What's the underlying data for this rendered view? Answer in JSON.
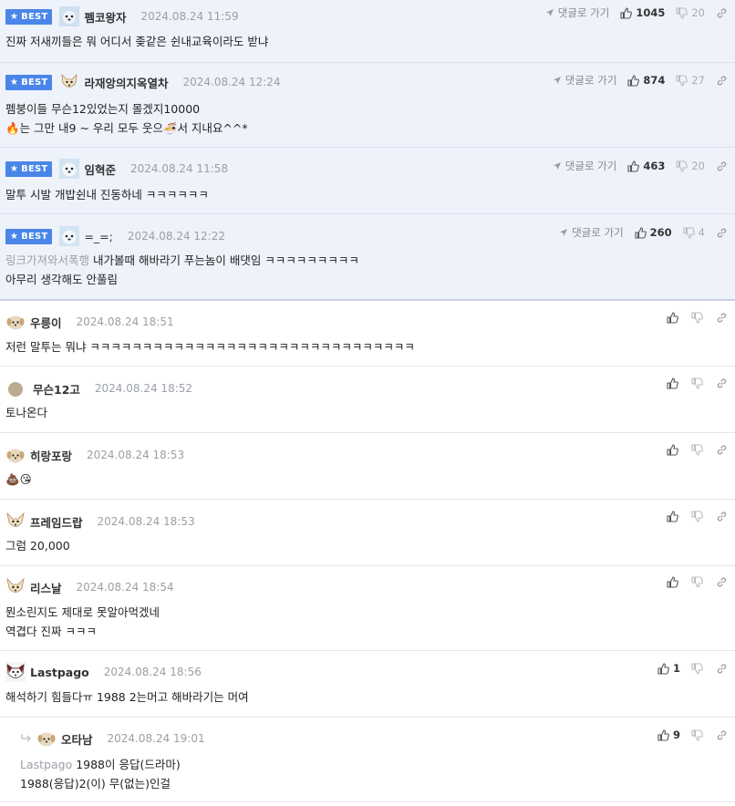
{
  "reply_label": "댓글로 가기",
  "best_label": "BEST",
  "best_comments": [
    {
      "nick": "펨코왕자",
      "date": "2024.08.24 11:59",
      "likes": "1045",
      "dislikes": "20",
      "lines": [
        "진짜 저새끼들은 뭐 어디서 좆같은 쉰내교육이라도 받냐"
      ]
    },
    {
      "nick": "라재앙의지옥열차",
      "date": "2024.08.24 12:24",
      "likes": "874",
      "dislikes": "27",
      "lines": [
        "펨붕이들 무슨12있었는지 몰겠지10000",
        "는 그만 내9 ~ 우리 모두 웃으",
        "서 지내요^^*"
      ]
    },
    {
      "nick": "임혁준",
      "date": "2024.08.24 11:58",
      "likes": "463",
      "dislikes": "20",
      "lines": [
        "말투 시발 개밥쉰내 진동하네 ㅋㅋㅋㅋㅋㅋ"
      ]
    },
    {
      "nick": "=_=;",
      "date": "2024.08.24 12:22",
      "likes": "260",
      "dislikes": "4",
      "link": "링크가져와서폭행",
      "lines": [
        " 내가볼때 해바라기 푸는놈이 배댓임 ㅋㅋㅋㅋㅋㅋㅋㅋㅋ",
        "아무리 생각해도 안풀림"
      ]
    }
  ],
  "comments": [
    {
      "nick": "우릉이",
      "date": "2024.08.24 18:51",
      "lines": [
        "저런 말투는 뭐냐 ㅋㅋㅋㅋㅋㅋㅋㅋㅋㅋㅋㅋㅋㅋㅋㅋㅋㅋㅋㅋㅋㅋㅋㅋㅋㅋㅋㅋㅋㅋㅋ"
      ]
    },
    {
      "nick": "무슨12고",
      "date": "2024.08.24 18:52",
      "lines": [
        "토나온다"
      ]
    },
    {
      "nick": "히랑포랑",
      "date": "2024.08.24 18:53",
      "lines": [
        "💩😘"
      ]
    },
    {
      "nick": "프레임드랍",
      "date": "2024.08.24 18:53",
      "lines": [
        "그럼 20,000"
      ]
    },
    {
      "nick": "리스날",
      "date": "2024.08.24 18:54",
      "lines": [
        "뭔소린지도 제대로 못알아먹겠네",
        "역겹다 진짜 ㅋㅋㅋ"
      ]
    },
    {
      "nick": "Lastpago",
      "date": "2024.08.24 18:56",
      "likes": "1",
      "lines": [
        "해석하기 힘들다ㅠ 1988 2는머고 해바라기는 머여"
      ]
    },
    {
      "nick": "오타남",
      "date": "2024.08.24 19:01",
      "likes": "9",
      "mention": "Lastpago",
      "lines": [
        " 1988이 응답(드라마)",
        "1988(응답)2(이) 무(없는)인걸"
      ]
    }
  ],
  "colors": {
    "best_bg": "#eef2fb",
    "badge": "#4a86e8",
    "date": "#9aa0a6"
  }
}
